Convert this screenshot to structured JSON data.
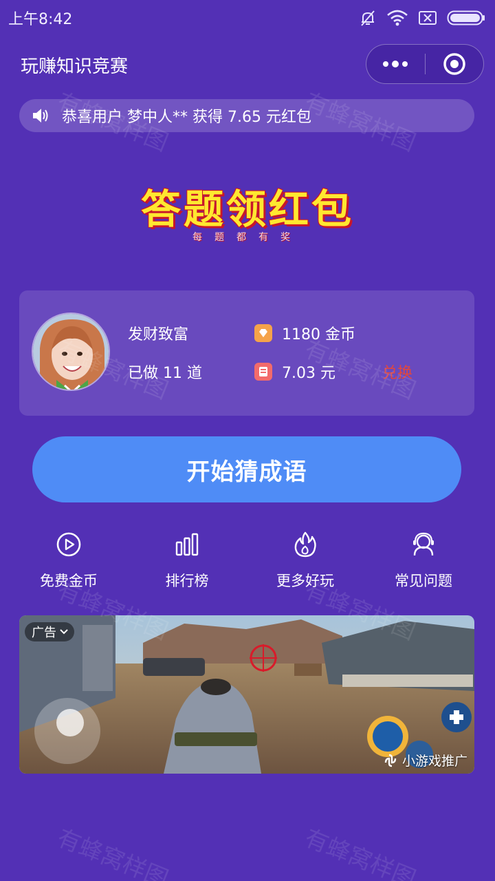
{
  "status_bar": {
    "time": "上午8:42"
  },
  "app": {
    "title": "玩赚知识竞赛"
  },
  "marquee": {
    "text": "恭喜用户 梦中人** 获得 7.65 元红包"
  },
  "banner": {
    "title": "答题领红包",
    "subtitle": "每题都有奖"
  },
  "user": {
    "name": "发财致富",
    "done": "已做 11 道",
    "coins": "1180 金币",
    "cash": "7.03 元",
    "exchange_label": "兑换"
  },
  "start_button": {
    "label": "开始猜成语"
  },
  "nav": [
    {
      "label": "免费金币",
      "icon": "play-circle-icon"
    },
    {
      "label": "排行榜",
      "icon": "bar-chart-icon"
    },
    {
      "label": "更多好玩",
      "icon": "flame-icon"
    },
    {
      "label": "常见问题",
      "icon": "support-person-icon"
    }
  ],
  "ad": {
    "tag": "广告",
    "source": "小游戏推广"
  },
  "watermark": "有蜂窝样图",
  "colors": {
    "background": "#5330b5",
    "primary_button": "#4f8cf6",
    "exchange": "#e2473d",
    "coin": "#f5a34a",
    "cash": "#f26b6b"
  }
}
